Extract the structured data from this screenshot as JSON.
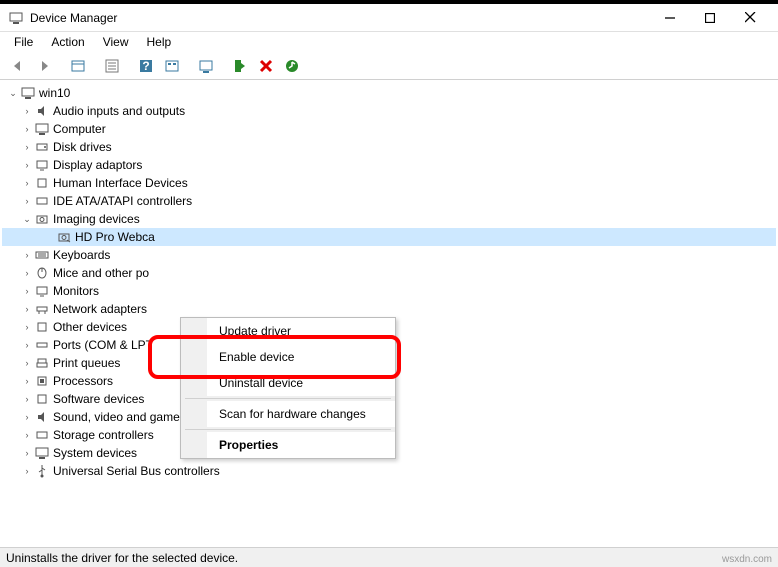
{
  "window": {
    "title": "Device Manager"
  },
  "menu": {
    "file": "File",
    "action": "Action",
    "view": "View",
    "help": "Help"
  },
  "root": "win10",
  "nodes": {
    "audio": "Audio inputs and outputs",
    "computer": "Computer",
    "disk": "Disk drives",
    "display": "Display adaptors",
    "hid": "Human Interface Devices",
    "ide": "IDE ATA/ATAPI controllers",
    "imaging": "Imaging devices",
    "webcam": "HD Pro Webca",
    "keyboards": "Keyboards",
    "mice": "Mice and other po",
    "monitors": "Monitors",
    "netadapters": "Network adapters",
    "other": "Other devices",
    "ports": "Ports (COM & LPT",
    "printq": "Print queues",
    "proc": "Processors",
    "soft": "Software devices",
    "sound": "Sound, video and game controllers",
    "storage": "Storage controllers",
    "system": "System devices",
    "usb": "Universal Serial Bus controllers"
  },
  "context": {
    "update": "Update driver",
    "enable": "Enable device",
    "uninstall": "Uninstall device",
    "scan": "Scan for hardware changes",
    "properties": "Properties"
  },
  "status": "Uninstalls the driver for the selected device.",
  "watermark": "wsxdn.com"
}
